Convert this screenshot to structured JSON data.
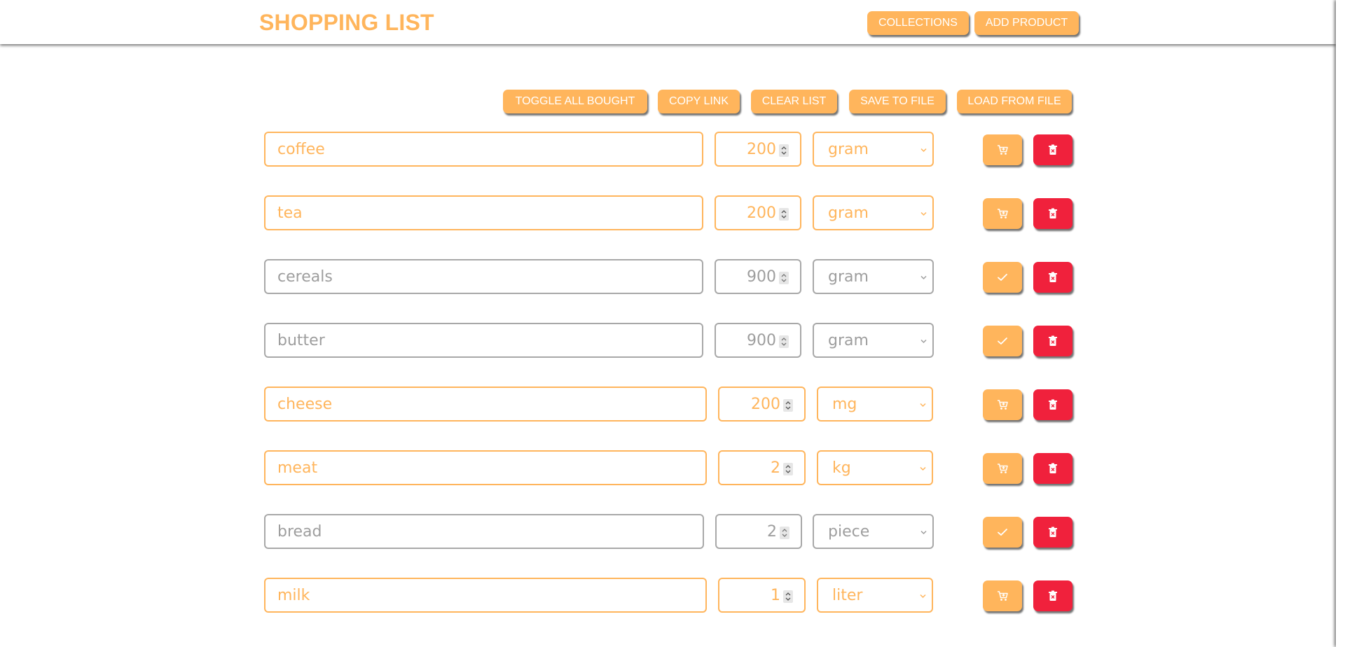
{
  "header": {
    "title": "SHOPPING LIST",
    "collections_label": "COLLECTIONS",
    "add_product_label": "ADD PRODUCT"
  },
  "toolbar": {
    "toggle_all_label": "TOGGLE ALL BOUGHT",
    "copy_link_label": "COPY LINK",
    "clear_list_label": "CLEAR LIST",
    "save_label": "SAVE TO FILE",
    "load_label": "LOAD FROM FILE"
  },
  "colors": {
    "accent": "#ffb55c",
    "delete": "#f0213c",
    "bought_border": "#a8a8a8",
    "bought_text": "#9e9e9e"
  },
  "items": [
    {
      "name": "coffee",
      "quantity": "200",
      "unit": "gram",
      "bought": false,
      "toggle_icon": "cart-icon",
      "delete_icon": "trash-icon"
    },
    {
      "name": "tea",
      "quantity": "200",
      "unit": "gram",
      "bought": false,
      "toggle_icon": "cart-icon",
      "delete_icon": "trash-icon"
    },
    {
      "name": "cereals",
      "quantity": "900",
      "unit": "gram",
      "bought": true,
      "toggle_icon": "check-icon",
      "delete_icon": "trash-icon"
    },
    {
      "name": "butter",
      "quantity": "900",
      "unit": "gram",
      "bought": true,
      "toggle_icon": "check-icon",
      "delete_icon": "trash-icon"
    },
    {
      "name": "cheese",
      "quantity": "200",
      "unit": "mg",
      "bought": false,
      "toggle_icon": "cart-icon",
      "delete_icon": "trash-icon"
    },
    {
      "name": "meat",
      "quantity": "2",
      "unit": "kg",
      "bought": false,
      "toggle_icon": "cart-icon",
      "delete_icon": "trash-icon"
    },
    {
      "name": "bread",
      "quantity": "2",
      "unit": "piece",
      "bought": true,
      "toggle_icon": "check-icon",
      "delete_icon": "trash-icon"
    },
    {
      "name": "milk",
      "quantity": "1",
      "unit": "liter",
      "bought": false,
      "toggle_icon": "cart-icon",
      "delete_icon": "trash-icon"
    }
  ]
}
